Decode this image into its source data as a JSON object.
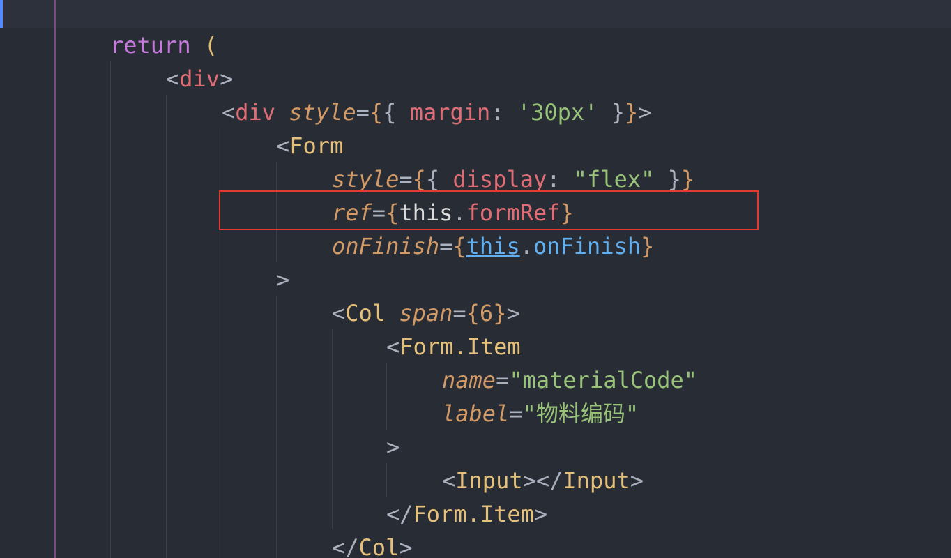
{
  "editor": {
    "theme_colors": {
      "background": "#282c34",
      "keyword": "#c678dd",
      "tag": "#e06c75",
      "component": "#e5c07b",
      "attribute": "#d19a66",
      "string": "#98c379",
      "function": "#61afef",
      "highlight_box": "#e53935"
    },
    "code": {
      "l2": {
        "kw": "return",
        "paren": "("
      },
      "l3": {
        "open": "<",
        "tag": "div",
        "close": ">"
      },
      "l4": {
        "open": "<",
        "tag": "div",
        "attr": "style",
        "eq": "=",
        "b1": "{",
        "b2": "{",
        "prop": "margin",
        "colon": ":",
        "val": "'30px'",
        "b3": "}",
        "b4": "}",
        "close": ">"
      },
      "l5": {
        "open": "<",
        "comp": "Form"
      },
      "l6": {
        "attr": "style",
        "eq": "=",
        "b1": "{",
        "b2": "{",
        "prop": "display",
        "colon": ":",
        "val": "\"flex\"",
        "b3": "}",
        "b4": "}"
      },
      "l7": {
        "attr": "ref",
        "eq": "=",
        "b1": "{",
        "obj": "this",
        "dot": ".",
        "member": "formRef",
        "b2": "}"
      },
      "l8": {
        "attr": "onFinish",
        "eq": "=",
        "b1": "{",
        "obj": "this",
        "dot": ".",
        "member": "onFinish",
        "b2": "}"
      },
      "l9": {
        "close": ">"
      },
      "l10": {
        "open": "<",
        "comp": "Col",
        "attr": "span",
        "eq": "=",
        "b1": "{",
        "num": "6",
        "b2": "}",
        "close": ">"
      },
      "l11": {
        "open": "<",
        "comp": "Form.Item"
      },
      "l12": {
        "attr": "name",
        "eq": "=",
        "val": "\"materialCode\""
      },
      "l13": {
        "attr": "label",
        "eq": "=",
        "val": "\"物料编码\""
      },
      "l14": {
        "close": ">"
      },
      "l15": {
        "open": "<",
        "comp": "Input",
        "mid": "></",
        "comp2": "Input",
        "close": ">"
      },
      "l16": {
        "open": "</",
        "comp": "Form.Item",
        "close": ">"
      },
      "l17": {
        "open": "</",
        "comp": "Col",
        "close": ">"
      }
    }
  }
}
